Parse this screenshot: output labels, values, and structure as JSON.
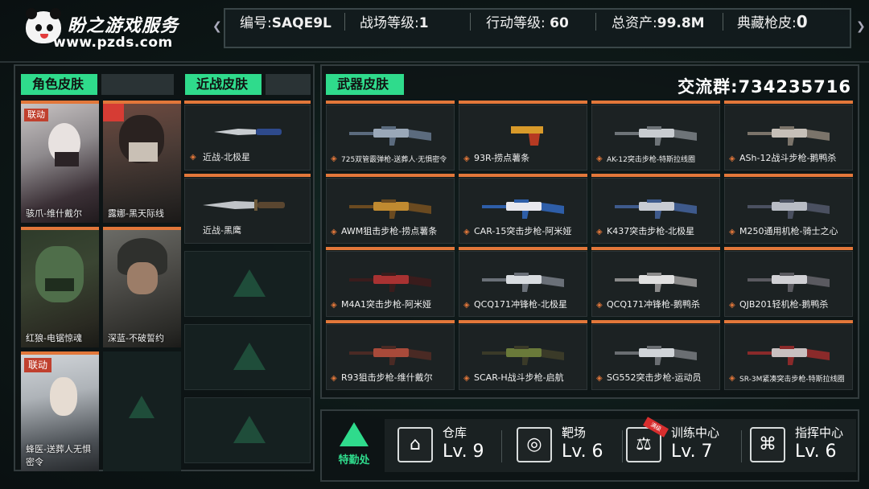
{
  "header": {
    "brand_title": "盼之游戏服务",
    "brand_url": "www.pzds.com",
    "stats": [
      {
        "label": "编号:",
        "value": "SAQE9L"
      },
      {
        "label": "战场等级:",
        "value": "1"
      },
      {
        "label": "行动等级:",
        "value": "60"
      },
      {
        "label": "总资产:",
        "value": "99.8M"
      },
      {
        "label": "典藏枪皮:",
        "value": "0"
      }
    ]
  },
  "character_panel": {
    "tab": "角色皮肤",
    "items": [
      {
        "label": "骇爪-维什戴尔",
        "tag": "联动"
      },
      {
        "label": "露娜-黑天际线",
        "tag": ""
      },
      {
        "label": "红狼-电锯惊魂",
        "tag": ""
      },
      {
        "label": "深蓝-不破誓约",
        "tag": ""
      },
      {
        "label": "蜂医-送葬人无惧密令",
        "tag": "联动"
      }
    ]
  },
  "melee_panel": {
    "tab": "近战皮肤",
    "items": [
      {
        "label": "近战-北极星"
      },
      {
        "label": "近战-黑鹰"
      }
    ]
  },
  "weapon_panel": {
    "tab": "武器皮肤",
    "group_text": "交流群:734235716",
    "items": [
      {
        "label": "725双管霰弹枪-送葬人·无惧密令"
      },
      {
        "label": "93R-捞点薯条"
      },
      {
        "label": "AK-12突击步枪-特斯拉线圈"
      },
      {
        "label": "ASh-12战斗步枪-鹅鸭杀"
      },
      {
        "label": "AWM狙击步枪-捞点薯条"
      },
      {
        "label": "CAR-15突击步枪-阿米娅"
      },
      {
        "label": "K437突击步枪-北极星"
      },
      {
        "label": "M250通用机枪-骑士之心"
      },
      {
        "label": "M4A1突击步枪-阿米娅"
      },
      {
        "label": "QCQ171冲锋枪-北极星"
      },
      {
        "label": "QCQ171冲锋枪-鹅鸭杀"
      },
      {
        "label": "QJB201轻机枪-鹅鸭杀"
      },
      {
        "label": "R93狙击步枪-维什戴尔"
      },
      {
        "label": "SCAR-H战斗步枪-启航"
      },
      {
        "label": "SG552突击步枪-运动员"
      },
      {
        "label": "SR-3M紧凑突击步枪-特斯拉线圈"
      }
    ]
  },
  "bottom": {
    "tqc_label": "特勤处",
    "facilities": [
      {
        "name": "仓库",
        "level": "Lv. 9",
        "icon": "warehouse-icon"
      },
      {
        "name": "靶场",
        "level": "Lv. 6",
        "icon": "target-icon"
      },
      {
        "name": "训练中心",
        "level": "Lv. 7",
        "icon": "dumbbell-icon",
        "ribbon": "满级"
      },
      {
        "name": "指挥中心",
        "level": "Lv. 6",
        "icon": "command-chip-icon"
      }
    ]
  },
  "colors": {
    "accent": "#2fdb8c",
    "card_top": "#e2773a",
    "tag": "#c0402e"
  }
}
